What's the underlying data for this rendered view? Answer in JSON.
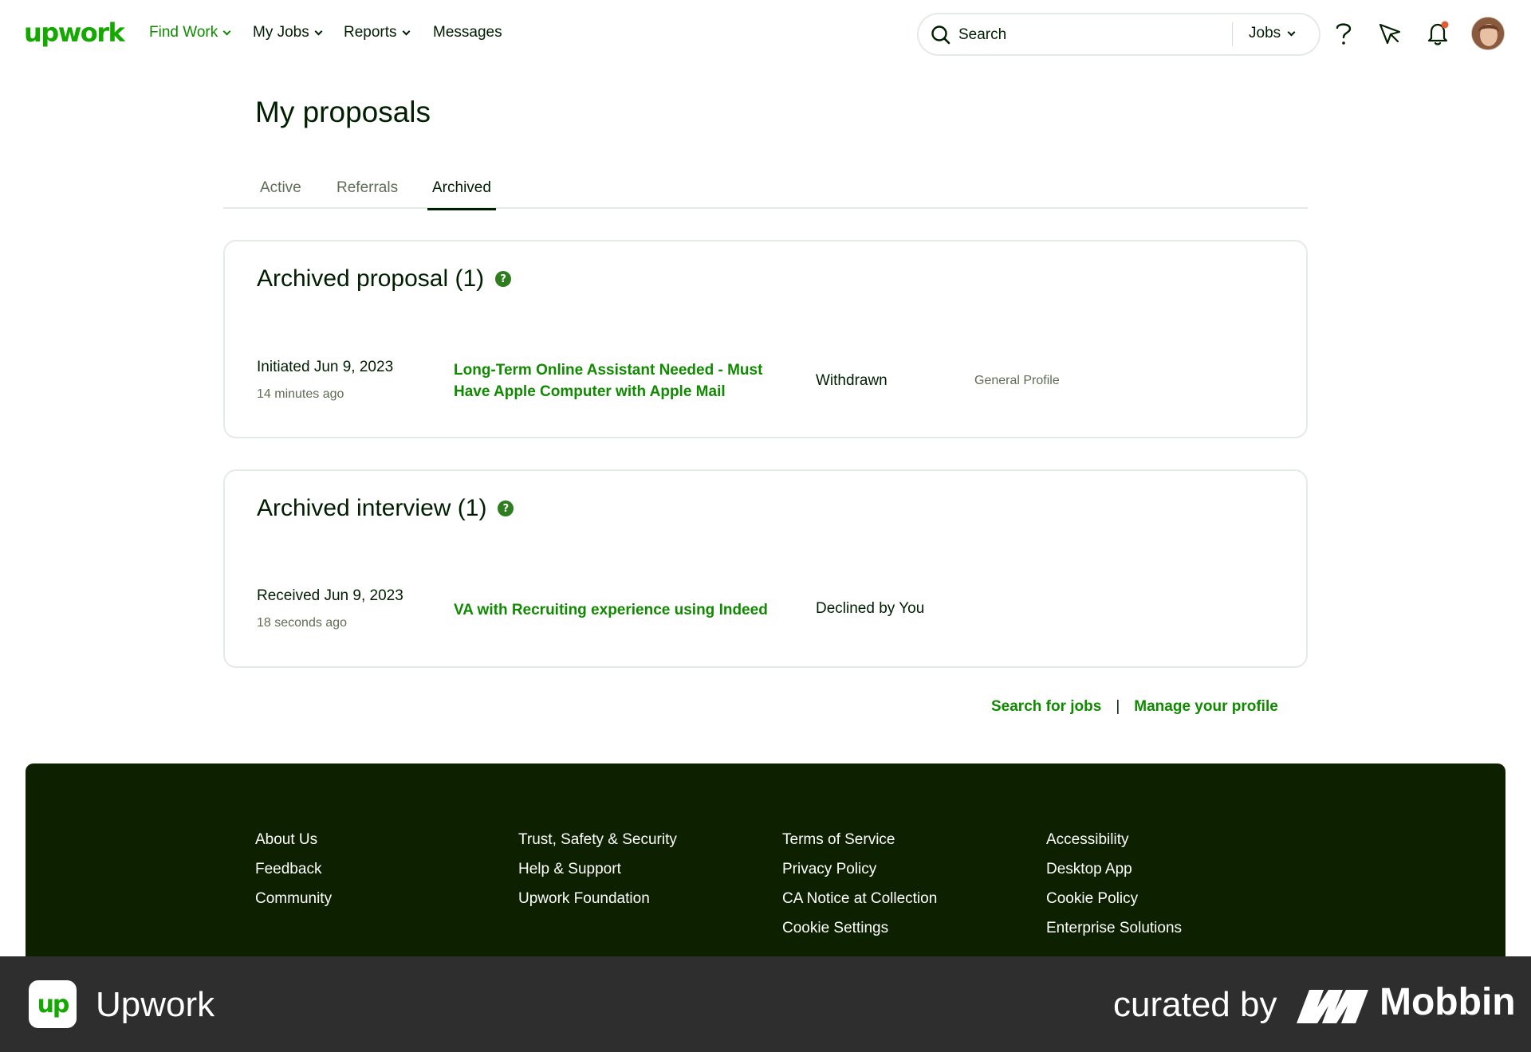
{
  "header": {
    "logo": "upwork",
    "nav": [
      {
        "label": "Find Work",
        "has_dropdown": true,
        "active": true
      },
      {
        "label": "My Jobs",
        "has_dropdown": true
      },
      {
        "label": "Reports",
        "has_dropdown": true
      },
      {
        "label": "Messages",
        "has_dropdown": false
      }
    ],
    "search": {
      "placeholder": "Search",
      "scope": "Jobs"
    },
    "icons": [
      "question-icon",
      "send-icon",
      "bell-icon",
      "avatar"
    ],
    "notification_dot_color": "#e25c32"
  },
  "page": {
    "title": "My proposals",
    "tabs": [
      {
        "label": "Active"
      },
      {
        "label": "Referrals"
      },
      {
        "label": "Archived",
        "selected": true
      }
    ]
  },
  "archived_proposals": {
    "title": "Archived proposal (1)",
    "help_icon": "question-circle-icon",
    "rows": [
      {
        "date": "Initiated Jun 9, 2023",
        "ago": "14 minutes ago",
        "job_title": "Long-Term Online Assistant Needed - Must Have Apple Computer with Apple Mail",
        "status": "Withdrawn",
        "profile": "General Profile"
      }
    ]
  },
  "archived_interviews": {
    "title": "Archived interview (1)",
    "help_icon": "question-circle-icon",
    "rows": [
      {
        "date": "Received Jun 9, 2023",
        "ago": "18 seconds ago",
        "job_title": "VA with Recruiting experience using Indeed",
        "status": "Declined by You"
      }
    ]
  },
  "bottom_links": {
    "search_jobs": "Search for jobs",
    "separator": "|",
    "manage_profile": "Manage your profile"
  },
  "footer": {
    "columns": [
      [
        "About Us",
        "Feedback",
        "Community"
      ],
      [
        "Trust, Safety & Security",
        "Help & Support",
        "Upwork Foundation"
      ],
      [
        "Terms of Service",
        "Privacy Policy",
        "CA Notice at Collection",
        "Cookie Settings"
      ],
      [
        "Accessibility",
        "Desktop App",
        "Cookie Policy",
        "Enterprise Solutions"
      ]
    ]
  },
  "banner": {
    "app_icon_text": "up",
    "app_name": "Upwork",
    "curated_by": "curated by",
    "brand": "Mobbin"
  },
  "colors": {
    "brand_green": "#14a800",
    "link_green": "#108a00",
    "footer_bg": "#0d2000",
    "banner_bg": "#2e2e2e"
  }
}
